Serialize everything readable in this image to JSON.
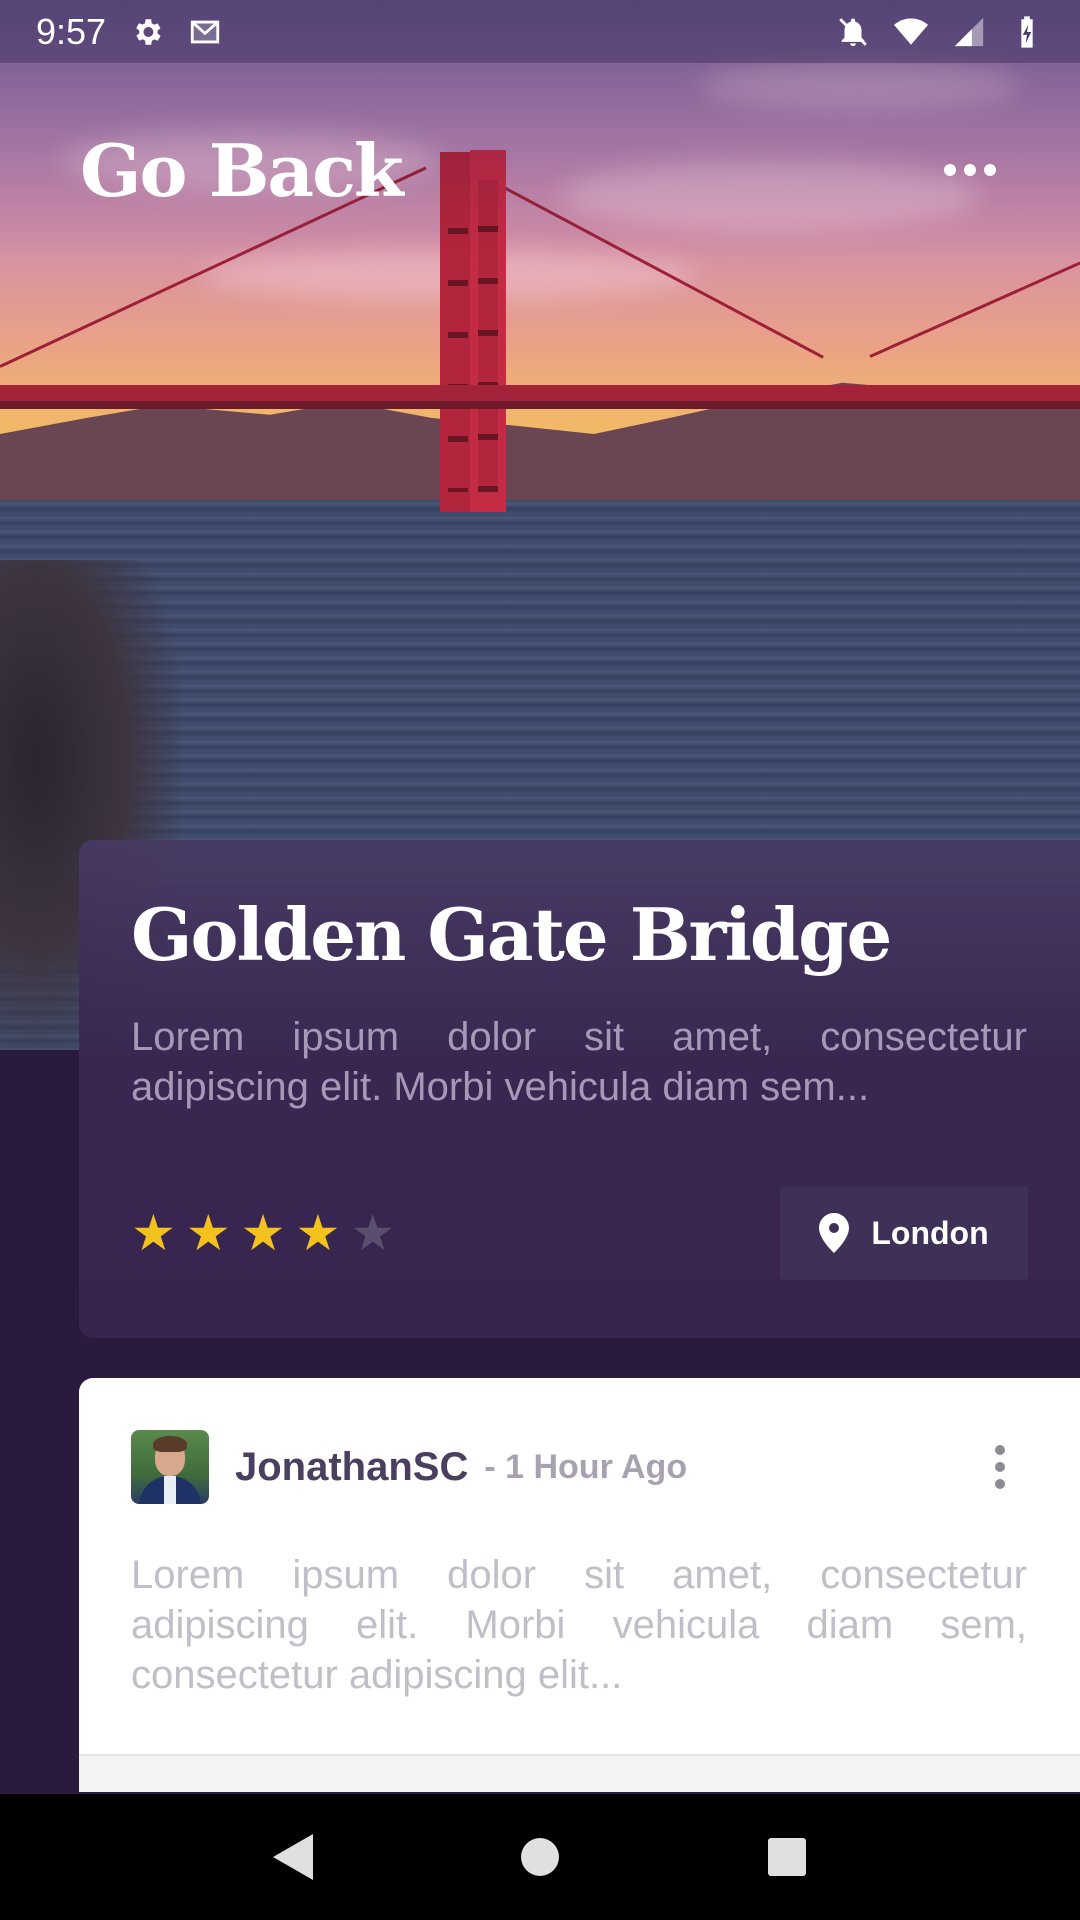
{
  "status_bar": {
    "time": "9:57",
    "left_icons": [
      "gear-icon",
      "gmail-icon"
    ],
    "right_icons": [
      "notifications-off-icon",
      "wifi-icon",
      "signal-icon",
      "battery-charging-icon"
    ]
  },
  "top_bar": {
    "title": "Go Back",
    "menu_icon": "more-horizontal-icon"
  },
  "place": {
    "title": "Golden Gate Bridge",
    "description": "Lorem ipsum dolor sit amet, consectetur adipiscing elit. Morbi vehicula diam sem...",
    "rating": 4,
    "rating_max": 5,
    "location_icon": "location-pin-icon",
    "location_label": "London"
  },
  "comment": {
    "user": "JonathanSC",
    "time_ago": "- 1 Hour Ago",
    "text": "Lorem ipsum dolor sit amet, consectetur adipiscing elit. Morbi vehicula diam sem, consectetur adipiscing elit...",
    "menu_icon": "more-vertical-icon"
  },
  "nav_bar": {
    "buttons": [
      "back-triangle-icon",
      "home-circle-icon",
      "recents-square-icon"
    ]
  },
  "colors": {
    "background": "#2a1a3e",
    "card": "#38244f",
    "star_on": "#f4c21e",
    "star_off": "#5b4d6e",
    "location_button": "#3f3057"
  }
}
